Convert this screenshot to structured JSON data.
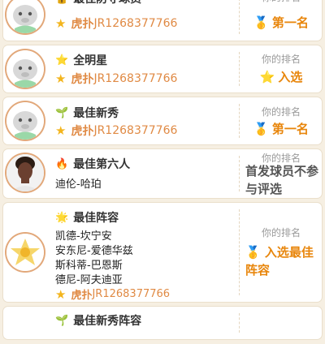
{
  "rank_label": "你的排名",
  "cards": [
    {
      "icon": "lock-icon",
      "icon_glyph": "🔒",
      "title": "最佳防守球员",
      "user": "虎扑JR1268377766",
      "user_bold": "虎扑",
      "rank_medal": "🥇",
      "rank": "第一名"
    },
    {
      "icon": "star-icon",
      "icon_glyph": "⭐",
      "title": "全明星",
      "user": "虎扑JR1268377766",
      "user_bold": "虎扑",
      "rank_medal": "⭐",
      "rank": "入选"
    },
    {
      "icon": "sprout-icon",
      "icon_glyph": "🌱",
      "title": "最佳新秀",
      "user": "虎扑JR1268377766",
      "user_bold": "虎扑",
      "rank_medal": "🥇",
      "rank": "第一名"
    },
    {
      "icon": "fire-icon",
      "icon_glyph": "🔥",
      "title": "最佳第六人",
      "player": "迪伦-哈珀",
      "rank": "首发球员不参与评选"
    },
    {
      "icon": "sparkle-icon",
      "icon_glyph": "🌟",
      "title": "最佳阵容",
      "players": [
        "凯德-坎宁安",
        "安东尼-爱德华兹",
        "斯科蒂-巴恩斯",
        "德尼-阿夫迪亚"
      ],
      "user": "虎扑JR1268377766",
      "user_bold": "虎扑",
      "rank_medal": "🥇",
      "rank": "入选最佳阵容"
    },
    {
      "icon": "sprout-icon",
      "icon_glyph": "🌱",
      "title": "最佳新秀阵容"
    }
  ]
}
